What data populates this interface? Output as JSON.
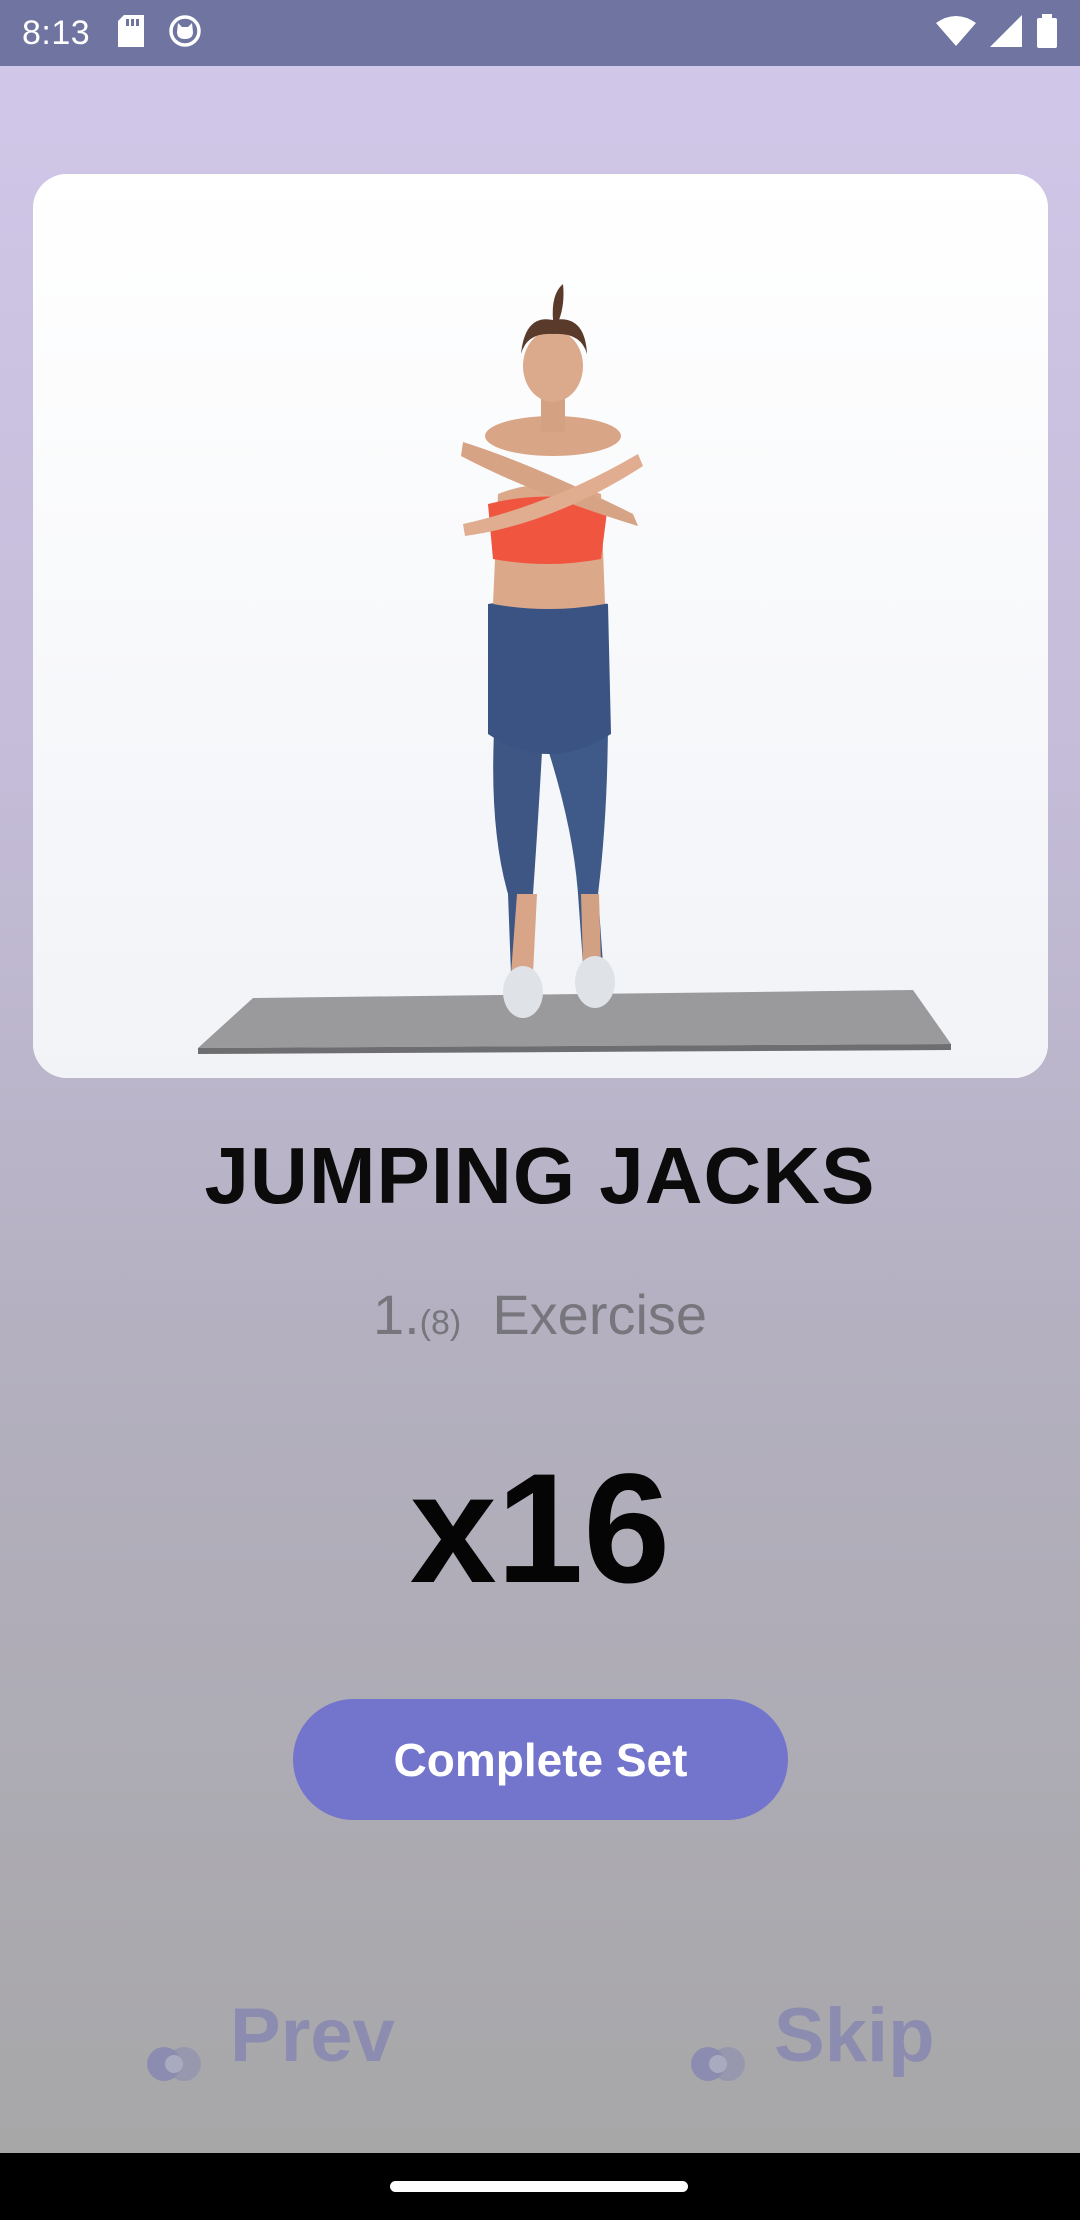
{
  "status_bar": {
    "time": "8:13",
    "left_icons": [
      "sd-card-icon",
      "cat-notification-icon"
    ],
    "right_icons": [
      "wifi-icon",
      "cell-signal-icon",
      "battery-icon"
    ]
  },
  "exercise": {
    "image_icon": "exercise-demo-image",
    "title": "JUMPING JACKS",
    "index": "1.",
    "total": "(8)",
    "label": "Exercise",
    "reps": "x16"
  },
  "actions": {
    "complete_label": "Complete Set",
    "prev_label": "Prev",
    "skip_label": "Skip"
  },
  "colors": {
    "status_bar": "#6f74a0",
    "primary_button": "#7374cc",
    "nav_text": "#8c8cb0"
  }
}
